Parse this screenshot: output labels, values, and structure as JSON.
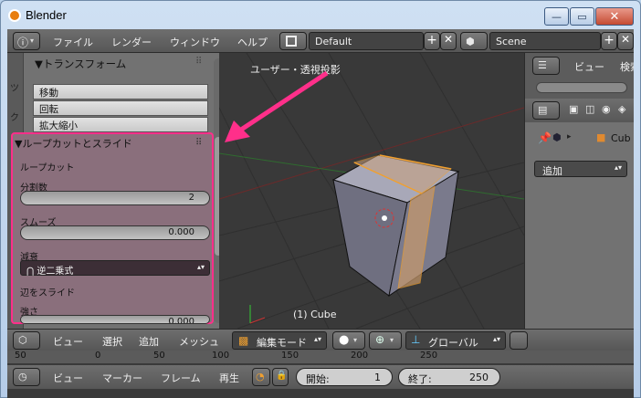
{
  "window": {
    "title": "Blender"
  },
  "menu": {
    "items": [
      "ファイル",
      "レンダー",
      "ウィンドウ",
      "ヘルプ"
    ]
  },
  "screen_layout": {
    "value": "Default"
  },
  "scene": {
    "value": "Scene"
  },
  "toolshelf": {
    "transform_header": "▼トランスフォーム",
    "buttons": [
      "移動",
      "回転",
      "拡大縮小"
    ],
    "loopcut_header": "▼ループカットとスライド",
    "loopcut_label": "ループカット",
    "cuts_label": "分割数",
    "cuts_value": "2",
    "smooth_label": "スムーズ",
    "smooth_value": "0.000",
    "falloff_label": "減衰",
    "falloff_value": "⋂ 逆二乗式",
    "edge_slide_label": "辺をスライド",
    "strength_label": "強さ",
    "strength_value": "0.000"
  },
  "viewport": {
    "view_label": "ユーザー・透視投影",
    "object_label": "(1) Cube"
  },
  "outliner": {
    "view_label": "ビュー",
    "search_label": "検索"
  },
  "properties": {
    "object_name": "Cub",
    "add_label": "追加"
  },
  "viewport_header": {
    "items": [
      "ビュー",
      "選択",
      "追加",
      "メッシュ"
    ],
    "mode_value": "編集モード",
    "orientation_value": "グローバル"
  },
  "ruler": {
    "ticks": [
      "50",
      "0",
      "50",
      "100",
      "150",
      "200",
      "250"
    ]
  },
  "timeline_header": {
    "items": [
      "ビュー",
      "マーカー",
      "フレーム",
      "再生"
    ],
    "start_label": "開始:",
    "start_value": "1",
    "end_label": "終了:",
    "end_value": "250"
  },
  "colors": {
    "highlight": "#ff2f8a",
    "accent": "#f0a030"
  }
}
